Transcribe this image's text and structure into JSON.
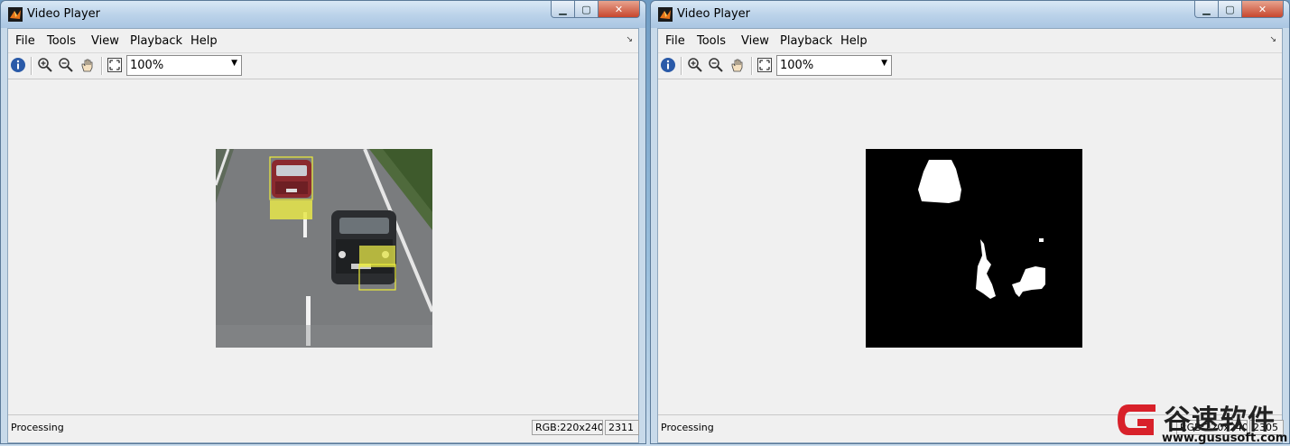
{
  "windows": [
    {
      "title": "Video Player",
      "menu": [
        "File",
        "Tools",
        "View",
        "Playback",
        "Help"
      ],
      "zoom": "100%",
      "status": "Processing",
      "info": "RGB:220x240",
      "frame_number": "2311"
    },
    {
      "title": "Video Player",
      "menu": [
        "File",
        "Tools",
        "View",
        "Playback",
        "Help"
      ],
      "zoom": "100%",
      "status": "Processing",
      "info": "RGB:220x240",
      "frame_number": "2305"
    }
  ],
  "watermark": {
    "text": "谷速软件",
    "url": "www.gususoft.com"
  },
  "colors": {
    "highlight": "#e8e84a",
    "mask_bg": "#000000",
    "mask_fg": "#ffffff"
  }
}
